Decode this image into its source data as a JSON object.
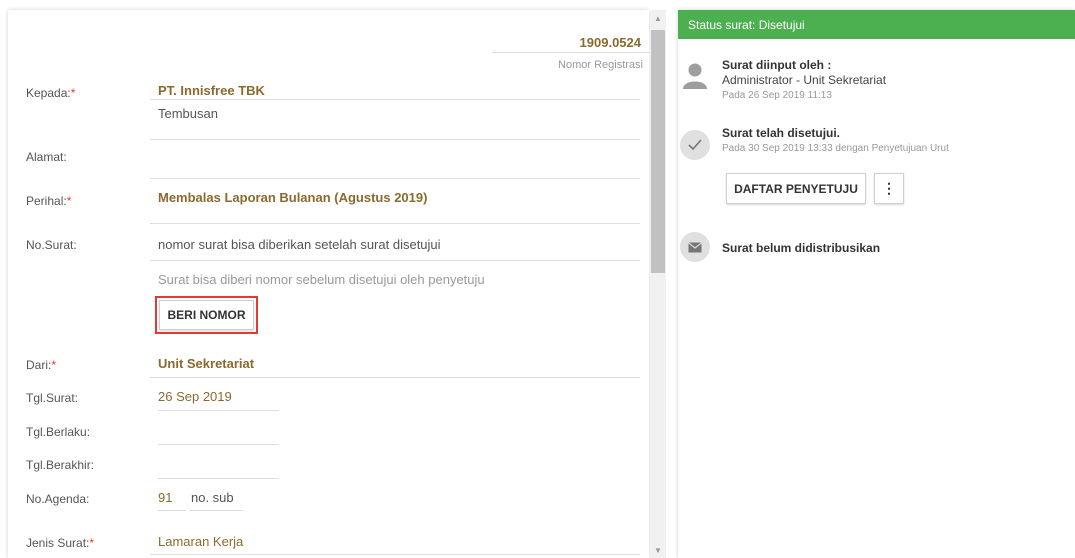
{
  "form": {
    "registration_number": "1909.0524",
    "registration_label": "Nomor Registrasi",
    "kepada_label": "Kepada:",
    "kepada_value": "PT. Innisfree TBK",
    "tembusan_placeholder": "Tembusan",
    "alamat_label": "Alamat:",
    "perihal_label": "Perihal:",
    "perihal_value": "Membalas Laporan Bulanan (Agustus 2019)",
    "no_surat_label": "No.Surat:",
    "no_surat_value": "nomor surat bisa diberikan setelah surat disetujui",
    "no_surat_hint": "Surat bisa diberi nomor sebelum disetujui oleh penyetuju",
    "beri_nomor_button": "BERI NOMOR",
    "dari_label": "Dari:",
    "dari_value": "Unit Sekretariat",
    "tgl_surat_label": "Tgl.Surat:",
    "tgl_surat_value": "26 Sep 2019",
    "tgl_berlaku_label": "Tgl.Berlaku:",
    "tgl_berakhir_label": "Tgl.Berakhir:",
    "no_agenda_label": "No.Agenda:",
    "no_agenda_value": "91",
    "no_sub_placeholder": "no. sub",
    "jenis_surat_label": "Jenis Surat:",
    "jenis_surat_value": "Lamaran Kerja",
    "required_mark": "*"
  },
  "status": {
    "header": "Status surat: Disetujui",
    "header_color": "#4caf50",
    "items": [
      {
        "icon": "user-avatar-icon",
        "title": "Surat diinput oleh :",
        "subtitle": "Administrator - Unit Sekretariat",
        "meta": "Pada 26 Sep 2019 11:13"
      },
      {
        "icon": "check-icon",
        "title": "Surat telah disetujui.",
        "meta": "Pada 30 Sep 2019 13:33 dengan Penyetujuan Urut"
      },
      {
        "icon": "envelope-icon",
        "title": "Surat belum didistribusikan"
      }
    ],
    "daftar_button": "DAFTAR PENYETUJU",
    "more_button": "⋮"
  },
  "colors": {
    "accent_text": "#8a6a2e",
    "required": "#e53935",
    "highlight_border": "#e53935"
  }
}
